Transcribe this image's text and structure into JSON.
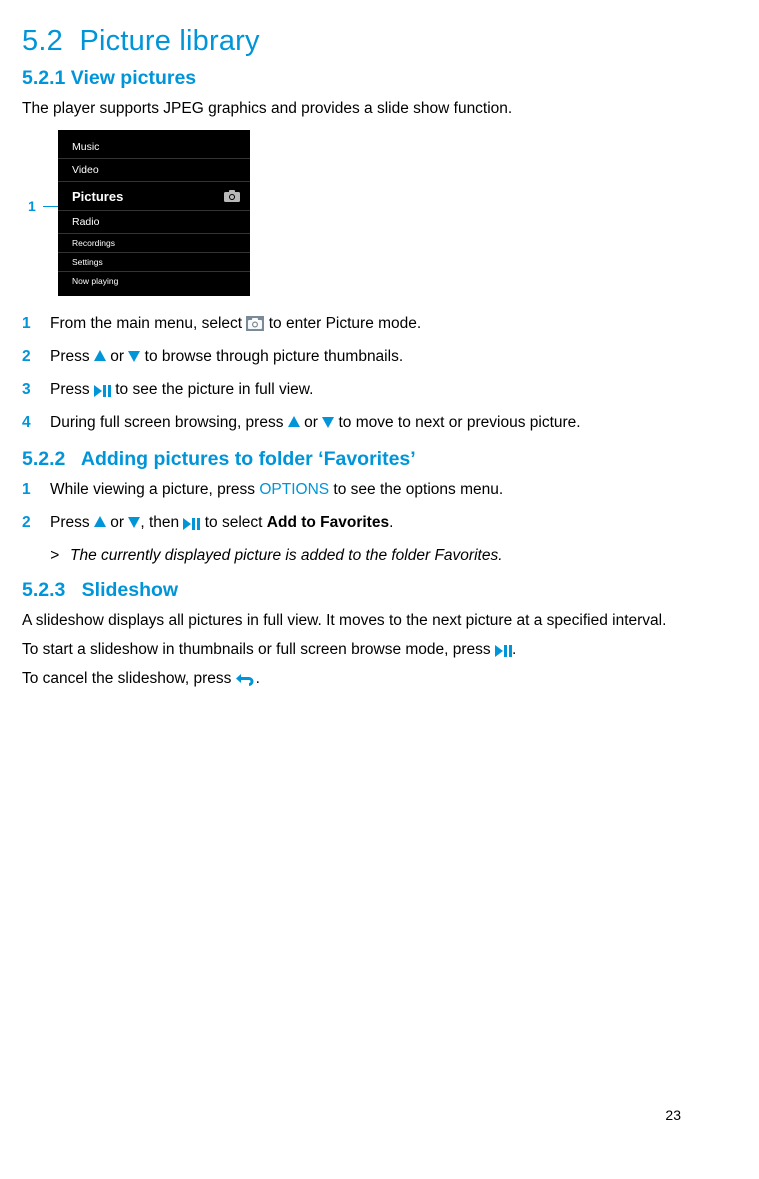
{
  "section": {
    "number": "5.2",
    "title": "Picture library"
  },
  "sub521": {
    "number": "5.2.1",
    "title": "View pictures",
    "intro": "The player supports JPEG graphics and provides a slide show function.",
    "callout": "1",
    "menu": {
      "items": [
        "Music",
        "Video",
        "Pictures",
        "Radio",
        "Recordings",
        "Settings",
        "Now playing"
      ],
      "selected": "Pictures"
    },
    "steps": {
      "s1a": "From the main menu, select ",
      "s1b": " to enter Picture mode.",
      "s2a": "Press ",
      "s2b": " or ",
      "s2c": " to browse through picture thumbnails.",
      "s3a": "Press ",
      "s3b": " to see the picture in full view.",
      "s4a": "During full screen browsing, press ",
      "s4b": " or ",
      "s4c": " to move to next or previous picture."
    }
  },
  "sub522": {
    "number": "5.2.2",
    "title": "Adding pictures to folder ‘Favorites’",
    "steps": {
      "s1a": "While viewing a picture, press ",
      "s1opt": "OPTIONS",
      "s1b": " to see the options menu.",
      "s2a": "Press ",
      "s2b": " or ",
      "s2c": ", then ",
      "s2d": " to select ",
      "s2bold": "Add to Favorites",
      "s2e": "."
    },
    "result": "The currently displayed picture is added to the folder Favorites."
  },
  "sub523": {
    "number": "5.2.3",
    "title": "Slideshow",
    "p1": "A slideshow displays all pictures in full view. It moves to the next picture at a specified interval.",
    "p2a": "To start a slideshow in thumbnails or full screen browse mode, press ",
    "p2b": ".",
    "p3a": "To cancel the slideshow, press ",
    "p3b": "."
  },
  "page": "23"
}
